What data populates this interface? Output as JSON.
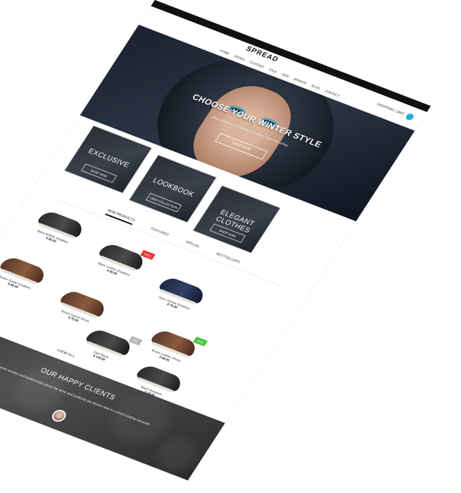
{
  "header": {
    "logo": "SPREAD",
    "nav": [
      "HOME",
      "SHOES",
      "CLOTHES",
      "SALE",
      "NEW",
      "BRANDS",
      "BLOG",
      "CONTACT"
    ],
    "cart_label": "SHOPPING CART"
  },
  "hero": {
    "headline": "CHOOSE YOUR WINTER STYLE",
    "subline": "Best collection of clothes to fit every taste this winter",
    "cta": "SHOP NOW"
  },
  "promos": [
    {
      "title": "EXCLUSIVE",
      "button": "SHOP NOW"
    },
    {
      "title": "LOOKBOOK",
      "button": "VIEW COLLECTION"
    },
    {
      "title": "ELEGANT CLOTHES",
      "button": "SHOP NOW"
    }
  ],
  "tabs": {
    "items": [
      "NEW PRODUCTS",
      "FEATURED",
      "SPECIAL",
      "BESTSELLERS"
    ],
    "active_index": 0
  },
  "products": [
    {
      "name": "Black Athletic Sneakers",
      "price": "$ 85.00",
      "badge": "",
      "shoe": "black"
    },
    {
      "name": "Black Leather Sneakers",
      "price": "$ 99.00",
      "badge": "SALE",
      "shoe": "black"
    },
    {
      "name": "Navy Canvas Sneakers",
      "price": "$ 75.00",
      "badge": "",
      "shoe": "navy"
    },
    {
      "name": "Brown Suede Sneakers",
      "price": "$ 80.00",
      "badge": "",
      "shoe": "brown"
    },
    {
      "name": "Brown Casual Shoes",
      "price": "$ 70.00",
      "badge": "",
      "shoe": "brown"
    },
    {
      "name": "Brown Leather Shoes",
      "price": "$ 89.00",
      "badge": "NEW",
      "shoe": "brown"
    },
    {
      "name": "Dark Boots",
      "price": "$ 120.00",
      "badge": "HOT",
      "shoe": "black"
    },
    {
      "name": "Black Sneakers",
      "price": "$ 79.00",
      "badge": "",
      "shoe": "black"
    }
  ],
  "view_all": "VIEW ALL",
  "testimonials": {
    "title": "OUR HAPPY CLIENTS",
    "quote": "Customer reviews and testimonials about the store and products are shown here in a short rotating carousel."
  },
  "colors": {
    "accent": "#1fb0e0",
    "sale": "#e53935",
    "new": "#45c43a"
  }
}
